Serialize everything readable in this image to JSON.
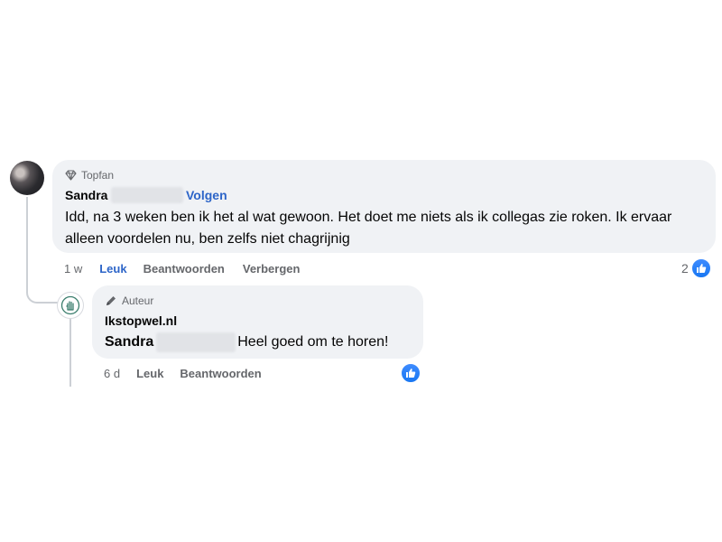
{
  "comment": {
    "badge_icon": "diamond-icon",
    "badge": "Topfan",
    "author": "Sandra",
    "follow_label": "Volgen",
    "text": "Idd, na 3 weken ben ik het al wat gewoon. Het doet me niets als ik collegas zie roken. Ik ervaar alleen voordelen nu, ben zelfs niet chagrijnig",
    "time": "1 w",
    "like_label": "Leuk",
    "reply_label": "Beantwoorden",
    "hide_label": "Verbergen",
    "reaction_count": "2",
    "reaction_icon": "thumbs-up-icon"
  },
  "reply": {
    "badge_icon": "pen-icon",
    "badge": "Auteur",
    "author": "Ikstopwel.nl",
    "mention": "Sandra",
    "text": "Heel goed om te horen!",
    "time": "6 d",
    "like_label": "Leuk",
    "reply_label": "Beantwoorden",
    "reaction_icon": "thumbs-up-icon"
  },
  "colors": {
    "bubble": "#f0f2f5",
    "link": "#2d65c8",
    "muted": "#65676b",
    "like": "#1877f2"
  }
}
